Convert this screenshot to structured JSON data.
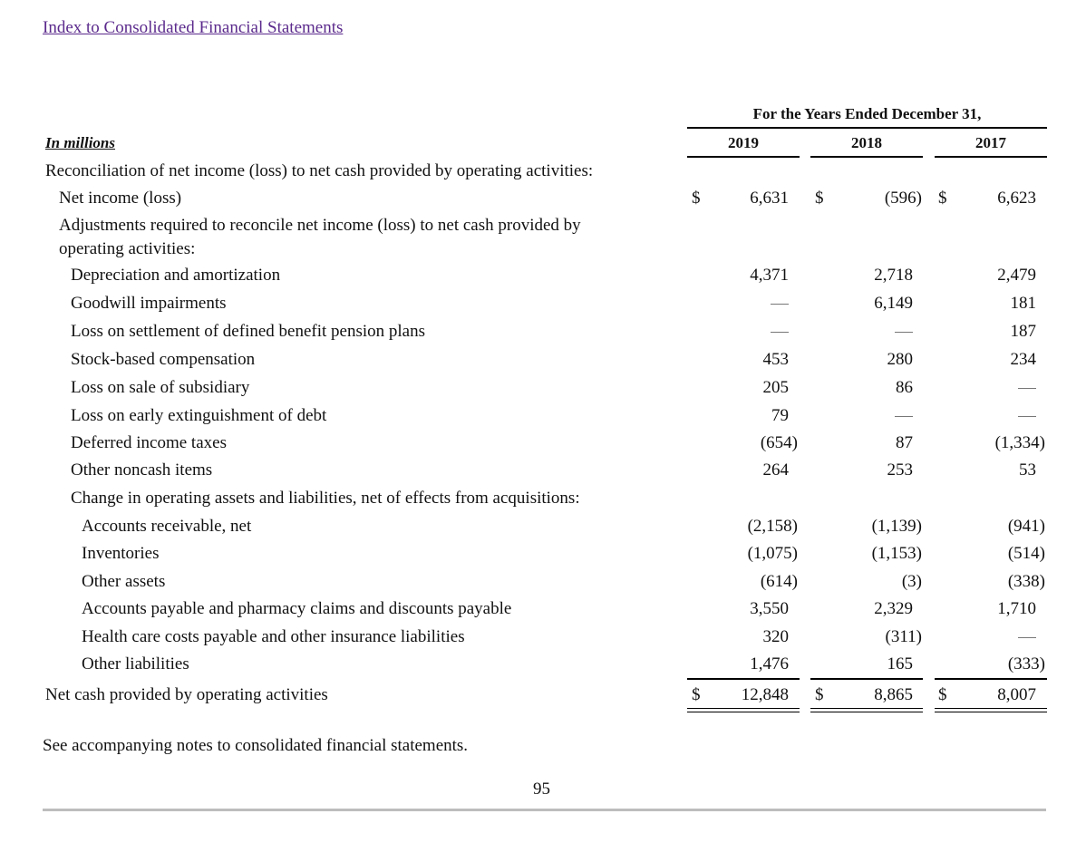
{
  "header": {
    "index_link": "Index to Consolidated Financial Statements",
    "units_label": "In millions",
    "period_label": "For the Years Ended December 31,",
    "years": [
      "2019",
      "2018",
      "2017"
    ]
  },
  "table": {
    "section_title": "Reconciliation of net income (loss) to net cash provided by operating activities:",
    "rows": [
      {
        "label": "Net income (loss)",
        "values": [
          "6,631",
          "(596)",
          "6,623"
        ],
        "dollar": true
      },
      {
        "label": "Adjustments required to reconcile net income (loss) to net cash provided by",
        "label2": "operating activities:"
      },
      {
        "label": "Depreciation and amortization",
        "values": [
          "4,371",
          "2,718",
          "2,479"
        ]
      },
      {
        "label": "Goodwill impairments",
        "values": [
          "—",
          "6,149",
          "181"
        ]
      },
      {
        "label": "Loss on settlement of defined benefit pension plans",
        "values": [
          "—",
          "—",
          "187"
        ]
      },
      {
        "label": "Stock-based compensation",
        "values": [
          "453",
          "280",
          "234"
        ]
      },
      {
        "label": "Loss on sale of subsidiary",
        "values": [
          "205",
          "86",
          "—"
        ]
      },
      {
        "label": "Loss on early extinguishment of debt",
        "values": [
          "79",
          "—",
          "—"
        ]
      },
      {
        "label": "Deferred income taxes",
        "values": [
          "(654)",
          "87",
          "(1,334)"
        ]
      },
      {
        "label": "Other noncash items",
        "values": [
          "264",
          "253",
          "53"
        ]
      },
      {
        "label": "Change in operating assets and liabilities, net of effects from acquisitions:"
      },
      {
        "label": "Accounts receivable, net",
        "values": [
          "(2,158)",
          "(1,139)",
          "(941)"
        ]
      },
      {
        "label": "Inventories",
        "values": [
          "(1,075)",
          "(1,153)",
          "(514)"
        ]
      },
      {
        "label": "Other assets",
        "values": [
          "(614)",
          "(3)",
          "(338)"
        ]
      },
      {
        "label": "Accounts payable and pharmacy claims and discounts payable",
        "values": [
          "3,550",
          "2,329",
          "1,710"
        ]
      },
      {
        "label": "Health care costs payable and other insurance liabilities",
        "values": [
          "320",
          "(311)",
          "—"
        ]
      },
      {
        "label": "Other liabilities",
        "values": [
          "1,476",
          "165",
          "(333)"
        ]
      },
      {
        "label": "Net cash provided by operating activities",
        "values": [
          "12,848",
          "8,865",
          "8,007"
        ],
        "dollar": true
      }
    ],
    "currency_symbol": "$"
  },
  "footer": {
    "note": "See accompanying notes to consolidated financial statements.",
    "page_number": "95"
  }
}
